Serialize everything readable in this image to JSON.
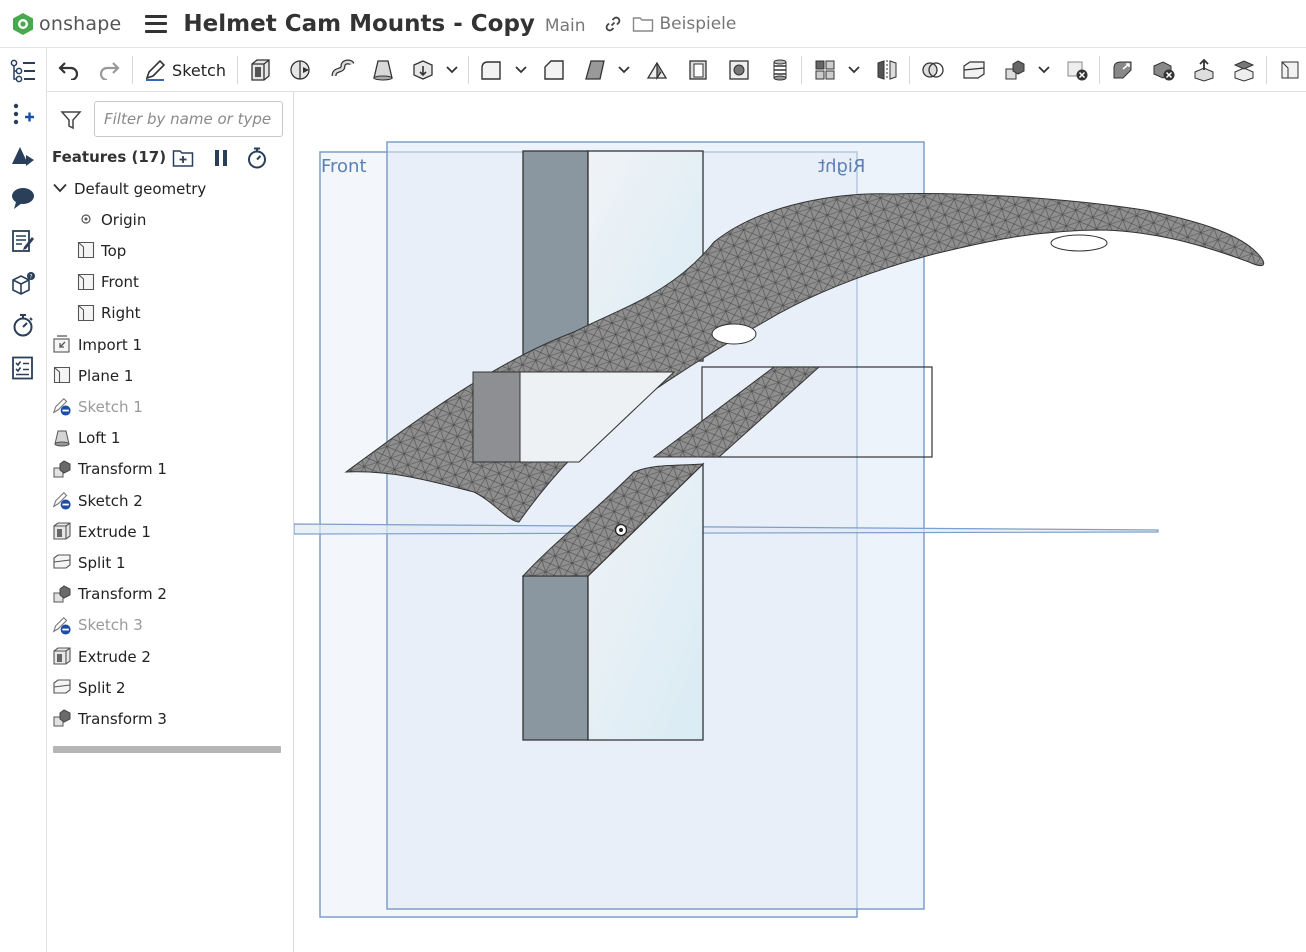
{
  "app": {
    "logo_text": "onshape",
    "document_title": "Helmet Cam Mounts - Copy",
    "branch": "Main",
    "folder": "Beispiele"
  },
  "toolbar": {
    "sketch_label": "Sketch"
  },
  "panel": {
    "filter_placeholder": "Filter by name or type",
    "features_title": "Features (17)",
    "default_geometry_label": "Default geometry",
    "default_geometry": [
      {
        "label": "Origin",
        "icon": "origin-icon"
      },
      {
        "label": "Top",
        "icon": "plane-icon"
      },
      {
        "label": "Front",
        "icon": "plane-icon"
      },
      {
        "label": "Right",
        "icon": "plane-icon"
      }
    ],
    "features": [
      {
        "label": "Import 1",
        "icon": "import-icon",
        "suppressed": false
      },
      {
        "label": "Plane 1",
        "icon": "plane-icon",
        "suppressed": false
      },
      {
        "label": "Sketch 1",
        "icon": "sketch-hidden-icon",
        "suppressed": true
      },
      {
        "label": "Loft 1",
        "icon": "loft-icon",
        "suppressed": false
      },
      {
        "label": "Transform 1",
        "icon": "transform-icon",
        "suppressed": false
      },
      {
        "label": "Sketch 2",
        "icon": "sketch-hidden-icon",
        "suppressed": false
      },
      {
        "label": "Extrude 1",
        "icon": "extrude-icon",
        "suppressed": false
      },
      {
        "label": "Split 1",
        "icon": "split-icon",
        "suppressed": false
      },
      {
        "label": "Transform 2",
        "icon": "transform-icon",
        "suppressed": false
      },
      {
        "label": "Sketch 3",
        "icon": "sketch-hidden-icon",
        "suppressed": true
      },
      {
        "label": "Extrude 2",
        "icon": "extrude-icon",
        "suppressed": false
      },
      {
        "label": "Split 2",
        "icon": "split-icon",
        "suppressed": false
      },
      {
        "label": "Transform 3",
        "icon": "transform-icon",
        "suppressed": false
      }
    ]
  },
  "viewport": {
    "front_plane_label": "Front",
    "right_plane_label": "Right"
  },
  "colors": {
    "accent": "#1d4ea6",
    "brand_green": "#47a84d",
    "plane_stroke": "#5a7fb5",
    "plane_fill": "#dfeaf5",
    "part_gray": "#8c99a3"
  }
}
